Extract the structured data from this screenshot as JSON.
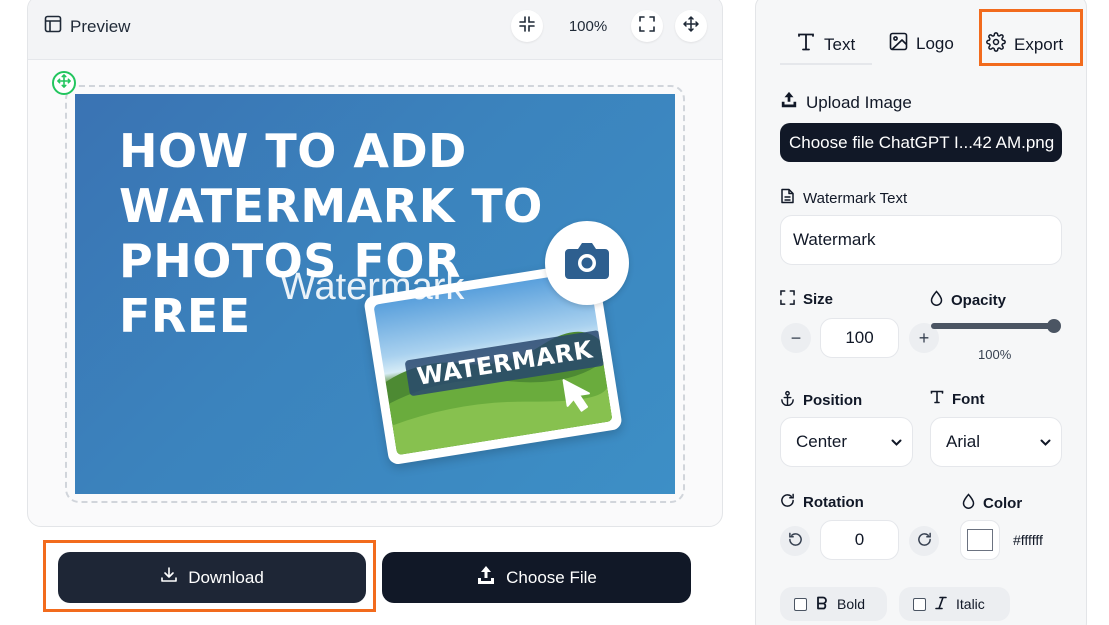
{
  "preview": {
    "title": "Preview",
    "zoom": "100%",
    "icons": [
      "layout-icon",
      "minimize-icon",
      "fullscreen-icon",
      "move-icon",
      "drag-handle-icon"
    ]
  },
  "artwork": {
    "heading_lines": [
      "HOW TO ADD",
      "WATERMARK TO",
      "PHOTOS FOR",
      "FREE"
    ],
    "watermark_overlay": "Watermark",
    "badge_text": "WATERMARK"
  },
  "actions": {
    "download_label": "Download",
    "choose_file_label": "Choose File"
  },
  "tabs": [
    {
      "label": "Text",
      "icon": "text-icon"
    },
    {
      "label": "Logo",
      "icon": "image-icon"
    },
    {
      "label": "Export",
      "icon": "gear-icon"
    }
  ],
  "upload": {
    "label": "Upload Image",
    "file_button": "Choose file ChatGPT I...42 AM.png"
  },
  "watermark_text": {
    "label": "Watermark Text",
    "value": "Watermark"
  },
  "size": {
    "label": "Size",
    "value": "100",
    "minus": "−",
    "plus": "+"
  },
  "opacity": {
    "label": "Opacity",
    "value": "100%",
    "level": 1.0
  },
  "position": {
    "label": "Position",
    "selected": "Center"
  },
  "font": {
    "label": "Font",
    "selected": "Arial"
  },
  "rotation": {
    "label": "Rotation",
    "value": "0"
  },
  "color": {
    "label": "Color",
    "value": "#ffffff"
  },
  "style": {
    "bold_label": "Bold",
    "italic_label": "Italic"
  },
  "colors": {
    "highlight": "#f26b1d",
    "dark_button": "#111827",
    "download_button": "#1e2636",
    "handle": "#22c55e"
  }
}
